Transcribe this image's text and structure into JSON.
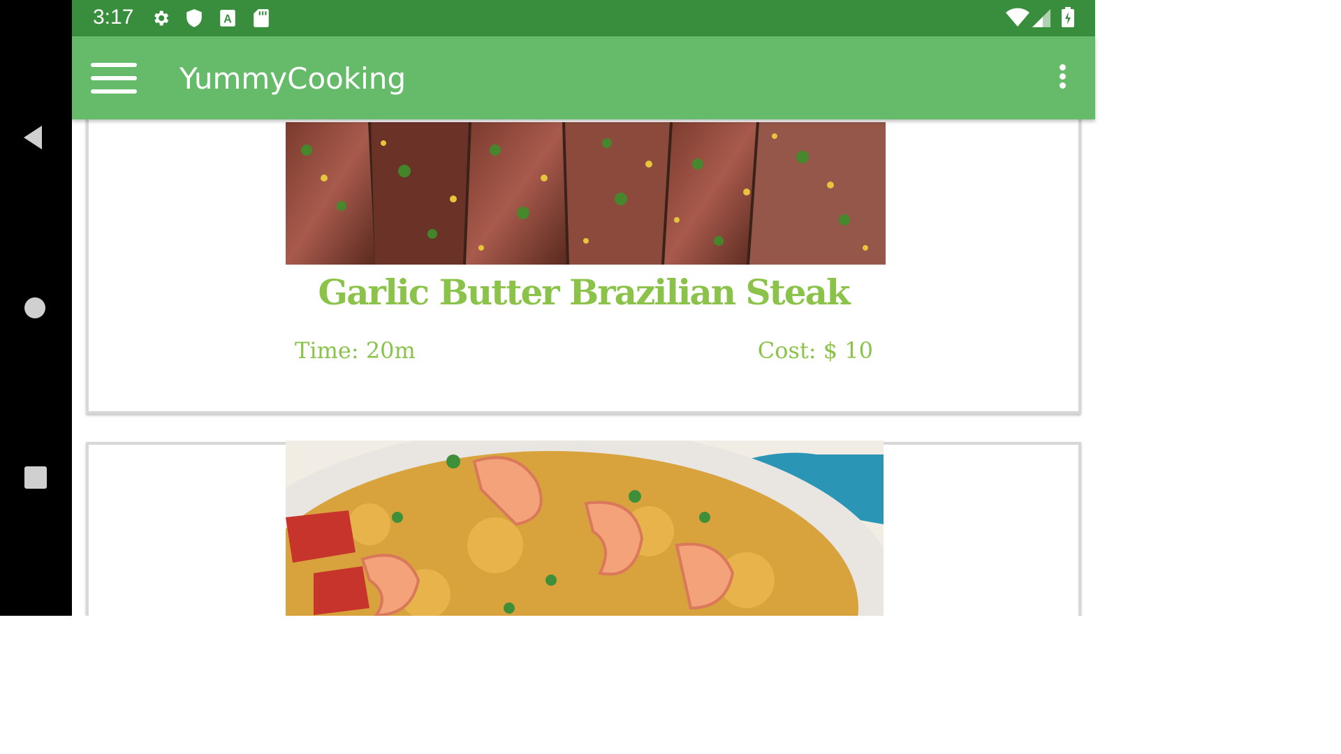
{
  "status_bar": {
    "time": "3:17",
    "icons": [
      "settings-icon",
      "shield-icon",
      "a-icon",
      "sd-card-icon",
      "wifi-icon",
      "signal-icon",
      "battery-icon"
    ]
  },
  "app_bar": {
    "title": "YummyCooking",
    "menu_icon": "hamburger-menu-icon",
    "overflow_icon": "more-vert-icon",
    "color": "#66bb6a",
    "status_color": "#388e3c"
  },
  "nav_bar": {
    "buttons": [
      "back-icon",
      "home-icon",
      "recents-icon"
    ]
  },
  "recipes": [
    {
      "title": "Garlic Butter Brazilian Steak",
      "time": "Time: 20m",
      "cost": "Cost: $ 10",
      "image": "sliced steak with garlic and herbs"
    },
    {
      "title": "",
      "image": "shrimp paella in blue pan"
    }
  ],
  "accent_color": "#8bc34a"
}
